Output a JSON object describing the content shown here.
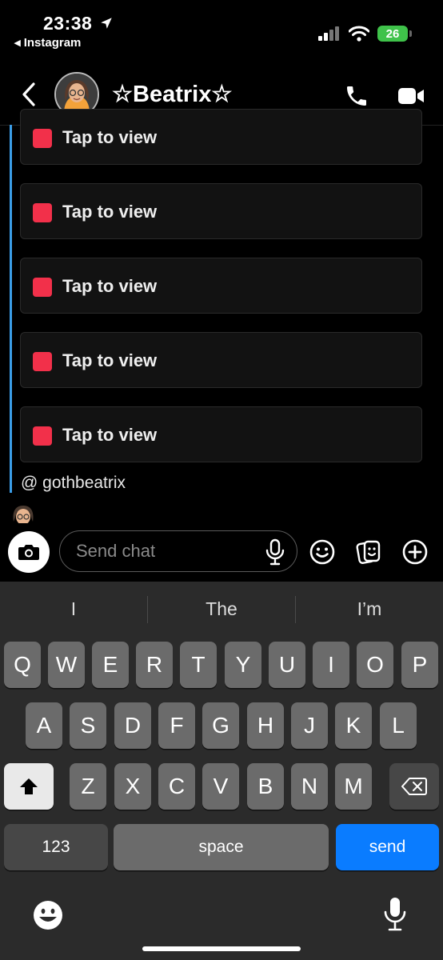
{
  "status_bar": {
    "time": "23:38",
    "back_app": "◂ Instagram",
    "battery": "26"
  },
  "header": {
    "title": "☆Beatrix☆"
  },
  "messages": {
    "snaps": [
      {
        "label": "Tap to view"
      },
      {
        "label": "Tap to view"
      },
      {
        "label": "Tap to view"
      },
      {
        "label": "Tap to view"
      },
      {
        "label": "Tap to view"
      }
    ],
    "mention": "@ gothbeatrix"
  },
  "composer": {
    "placeholder": "Send chat"
  },
  "keyboard": {
    "suggestions": [
      "I",
      "The",
      "I’m"
    ],
    "row1": [
      "Q",
      "W",
      "E",
      "R",
      "T",
      "Y",
      "U",
      "I",
      "O",
      "P"
    ],
    "row2": [
      "A",
      "S",
      "D",
      "F",
      "G",
      "H",
      "J",
      "K",
      "L"
    ],
    "row3": [
      "Z",
      "X",
      "C",
      "V",
      "B",
      "N",
      "M"
    ],
    "numbers_label": "123",
    "space_label": "space",
    "send_label": "send"
  },
  "colors": {
    "accent_blue": "#0a7cff",
    "snap_red": "#f2304a",
    "thread_line": "#3b9ee8",
    "battery_green": "#3fc24a"
  }
}
